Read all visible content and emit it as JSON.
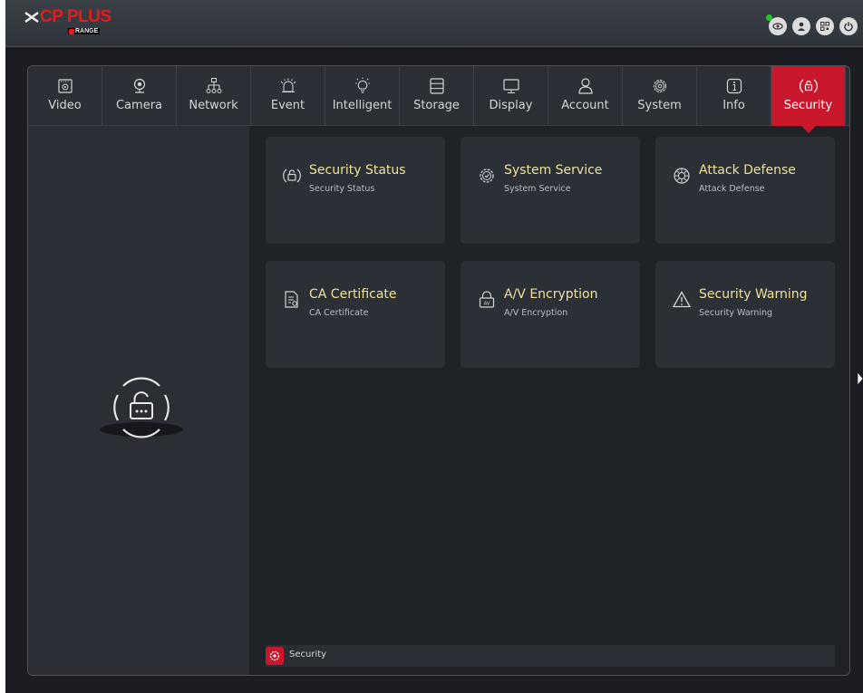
{
  "brand": {
    "name": "CP PLUS",
    "sub": "RANGE",
    "color": "#e41c1c"
  },
  "top_icons": [
    "eye-icon",
    "user-icon",
    "qr-code-icon",
    "power-icon"
  ],
  "tabs": [
    {
      "label": "Video",
      "icon": "video-icon"
    },
    {
      "label": "Camera",
      "icon": "camera-icon"
    },
    {
      "label": "Network",
      "icon": "network-icon"
    },
    {
      "label": "Event",
      "icon": "alarm-icon"
    },
    {
      "label": "Intelligent",
      "icon": "bulb-icon"
    },
    {
      "label": "Storage",
      "icon": "storage-icon"
    },
    {
      "label": "Display",
      "icon": "monitor-icon"
    },
    {
      "label": "Account",
      "icon": "account-icon"
    },
    {
      "label": "System",
      "icon": "gear-icon"
    },
    {
      "label": "Info",
      "icon": "info-icon"
    },
    {
      "label": "Security",
      "icon": "shield-lock-icon",
      "active": true
    }
  ],
  "cards": [
    {
      "title": "Security Status",
      "subtitle": "Security Status",
      "icon": "security-status-icon"
    },
    {
      "title": "System Service",
      "subtitle": "System Service",
      "icon": "system-service-icon"
    },
    {
      "title": "Attack Defense",
      "subtitle": "Attack Defense",
      "icon": "attack-defense-icon"
    },
    {
      "title": "CA Certificate",
      "subtitle": "CA Certificate",
      "icon": "certificate-icon"
    },
    {
      "title": "A/V Encryption",
      "subtitle": "A/V Encryption",
      "icon": "av-encryption-icon"
    },
    {
      "title": "Security Warning",
      "subtitle": "Security Warning",
      "icon": "warning-icon"
    }
  ],
  "status_bar": {
    "label": "Security"
  },
  "colors": {
    "accent": "#c9172b",
    "card_title": "#f0e19a",
    "background": "#1b1d22"
  }
}
